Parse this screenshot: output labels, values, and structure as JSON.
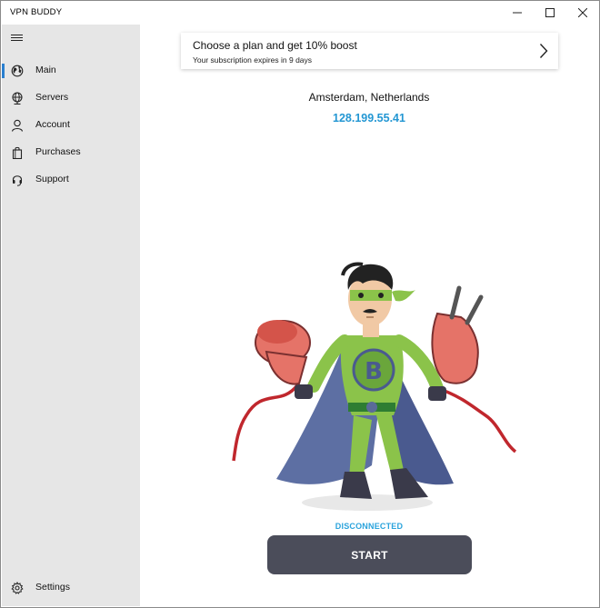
{
  "app": {
    "title": "VPN BUDDY"
  },
  "window_controls": [
    "minimize-icon",
    "maximize-icon",
    "close-icon"
  ],
  "sidebar": {
    "menu_icon": "hamburger-icon",
    "items": [
      {
        "label": "Main",
        "icon": "globe-icon",
        "active": true
      },
      {
        "label": "Servers",
        "icon": "server-globe-icon",
        "active": false
      },
      {
        "label": "Account",
        "icon": "person-icon",
        "active": false
      },
      {
        "label": "Purchases",
        "icon": "shopping-bag-icon",
        "active": false
      },
      {
        "label": "Support",
        "icon": "headset-icon",
        "active": false
      }
    ],
    "settings": {
      "label": "Settings",
      "icon": "gear-icon"
    }
  },
  "promo": {
    "title": "Choose a plan and get 10% boost",
    "subtitle": "Your subscription expires in 9 days",
    "icon": "chevron-right-icon"
  },
  "connection": {
    "location": "Amsterdam, Netherlands",
    "ip": "128.199.55.41",
    "status": "DISCONNECTED",
    "button_label": "START"
  },
  "colors": {
    "accent": "#2a7fcf",
    "ip_text": "#2497d3",
    "status_text": "#2aa3dc",
    "button_bg": "#4b4d5a",
    "sidebar_bg": "#e6e6e6"
  }
}
